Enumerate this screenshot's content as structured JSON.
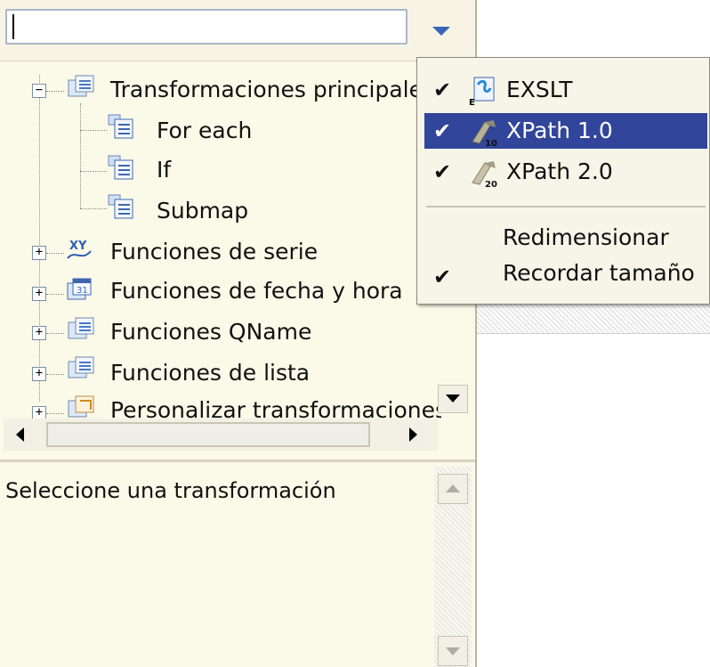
{
  "filter": {
    "value": ""
  },
  "tree": {
    "items": [
      {
        "label": "Transformaciones principales",
        "icon": "folder-transform-icon",
        "expanded": true
      },
      {
        "label": "For each",
        "icon": "document-icon"
      },
      {
        "label": "If",
        "icon": "document-icon"
      },
      {
        "label": "Submap",
        "icon": "document-icon"
      },
      {
        "label": "Funciones de serie",
        "icon": "xy-function-icon"
      },
      {
        "label": "Funciones de fecha y hora",
        "icon": "calendar-function-icon"
      },
      {
        "label": "Funciones QName",
        "icon": "folder-transform-icon"
      },
      {
        "label": "Funciones de lista",
        "icon": "folder-transform-icon"
      },
      {
        "label": "Personalizar transformaciones",
        "icon": "custom-transform-icon"
      }
    ]
  },
  "description": {
    "text": "Seleccione una transformación"
  },
  "menu": {
    "items": [
      {
        "label": "EXSLT",
        "checked": true,
        "icon": "exslt-icon",
        "selected": false
      },
      {
        "label": "XPath 1.0",
        "checked": true,
        "icon": "xpath-tool-icon",
        "selected": true
      },
      {
        "label": "XPath 2.0",
        "checked": true,
        "icon": "xpath-tool-icon",
        "selected": false
      },
      {
        "label": "Redimensionar",
        "checked": false
      },
      {
        "label": "Recordar tamaño",
        "checked": true
      }
    ],
    "check_glyph": "✔"
  },
  "colors": {
    "panel_bg": "#fbf9e8",
    "menu_bg": "#f7f4e8",
    "selection": "#31459a",
    "dropdown_arrow": "#3a66b8"
  }
}
